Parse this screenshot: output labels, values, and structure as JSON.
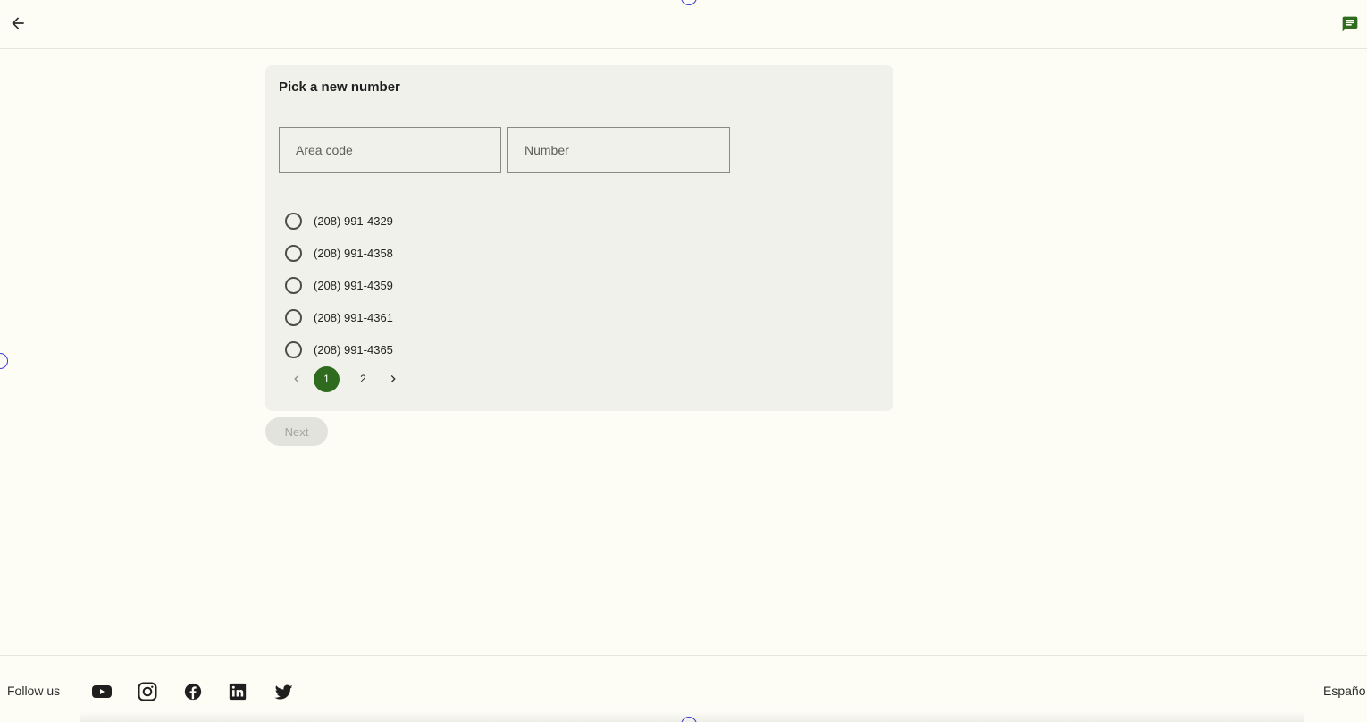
{
  "header": {
    "back_icon": "arrow-left-icon",
    "chat_icon": "chat-icon",
    "accent": "#2f6b1e"
  },
  "card": {
    "title": "Pick a new number",
    "area_code_placeholder": "Area code",
    "number_placeholder": "Number",
    "options": [
      {
        "label": "(208) 991-4329"
      },
      {
        "label": "(208) 991-4358"
      },
      {
        "label": "(208) 991-4359"
      },
      {
        "label": "(208) 991-4361"
      },
      {
        "label": "(208) 991-4365"
      }
    ],
    "pagination": {
      "prev_icon": "chevron-left-icon",
      "next_icon": "chevron-right-icon",
      "pages": [
        "1",
        "2"
      ],
      "current": "1"
    }
  },
  "next_button": "Next",
  "footer": {
    "follow_label": "Follow us",
    "social": [
      "youtube-icon",
      "instagram-icon",
      "facebook-icon",
      "linkedin-icon",
      "twitter-icon"
    ],
    "language_link": "Españo"
  }
}
